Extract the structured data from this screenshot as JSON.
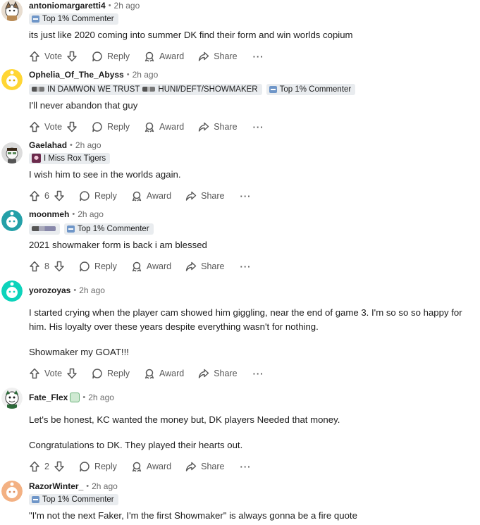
{
  "labels": {
    "vote": "Vote",
    "reply": "Reply",
    "award": "Award",
    "share": "Share",
    "more": "···",
    "dot": "•"
  },
  "comments": [
    {
      "author": "antoniomargaretti4",
      "time": "2h ago",
      "flairs": [
        "Top 1% Commenter"
      ],
      "body": [
        "its just like 2020 coming into summer DK find their form and win worlds copium"
      ],
      "votes": "Vote"
    },
    {
      "author": "Ophelia_Of_The_Abyss",
      "time": "2h ago",
      "flairs": [
        "IN DAMWON WE TRUST",
        "HUNI/DEFT/SHOWMAKER",
        "Top 1% Commenter"
      ],
      "body": [
        "I'll never abandon that guy"
      ],
      "votes": "Vote"
    },
    {
      "author": "Gaelahad",
      "time": "2h ago",
      "flairs": [
        "I Miss Rox Tigers"
      ],
      "body": [
        "I wish him to see in the worlds again."
      ],
      "votes": "6"
    },
    {
      "author": "moonmeh",
      "time": "2h ago",
      "flairs": [
        "Top 1% Commenter"
      ],
      "body": [
        "2021 showmaker form is back i am blessed"
      ],
      "votes": "8"
    },
    {
      "author": "yorozoyas",
      "time": "2h ago",
      "flairs": [],
      "body": [
        "I started crying when the player cam showed him giggling, near the end of game 3. I'm so so so happy for him. His loyalty over these years despite everything wasn't for nothing.",
        "Showmaker my GOAT!!!"
      ],
      "votes": "Vote"
    },
    {
      "author": "Fate_Flex",
      "time": "2h ago",
      "flairs": [],
      "body": [
        "Let's be honest, KC wanted the money but, DK players Needed that money.",
        "Congratulations to DK. They played their hearts out."
      ],
      "votes": "2"
    },
    {
      "author": "RazorWinter_",
      "time": "2h ago",
      "flairs": [
        "Top 1% Commenter"
      ],
      "body": [
        "\"I'm not the next Faker, I'm the first Showmaker\" is always gonna be a fire quote"
      ],
      "votes": ""
    }
  ],
  "colors": {
    "text": "#1c1c1c",
    "muted": "#575757",
    "flair_bg": "#e9ecef"
  }
}
